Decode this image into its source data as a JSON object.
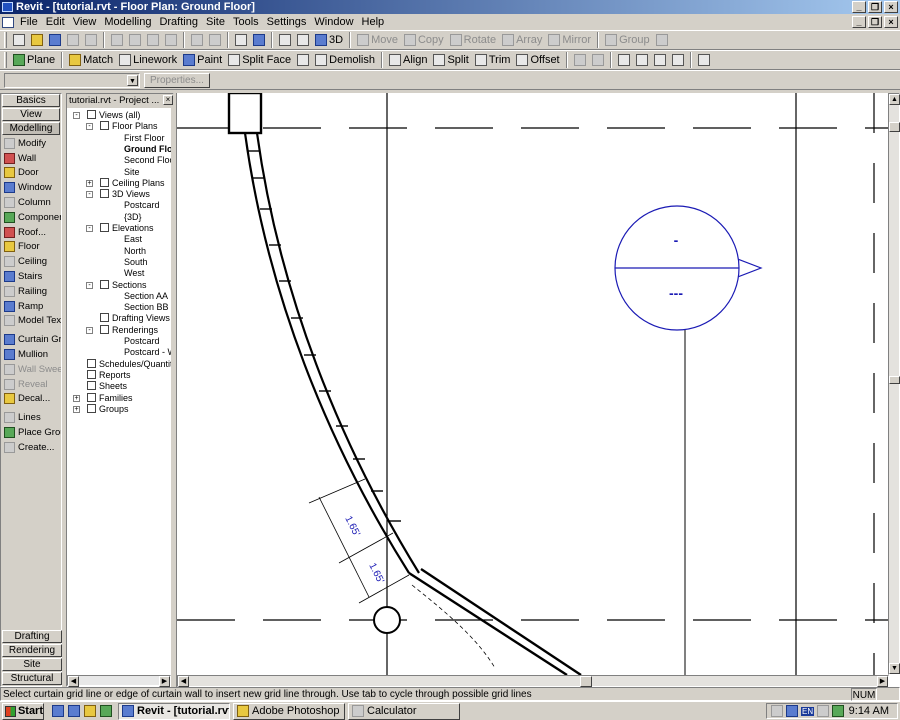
{
  "window": {
    "title": "Revit - [tutorial.rvt - Floor Plan: Ground Floor]"
  },
  "menu": [
    "File",
    "Edit",
    "View",
    "Modelling",
    "Drafting",
    "Site",
    "Tools",
    "Settings",
    "Window",
    "Help"
  ],
  "toolbar1": {
    "view_3d": "3D",
    "move": "Move",
    "copy": "Copy",
    "rotate": "Rotate",
    "array": "Array",
    "mirror": "Mirror",
    "group": "Group"
  },
  "toolbar2": {
    "plane": "Plane",
    "match": "Match",
    "linework": "Linework",
    "paint": "Paint",
    "split_face": "Split Face",
    "demolish": "Demolish",
    "align": "Align",
    "split": "Split",
    "trim": "Trim",
    "offset": "Offset"
  },
  "optionsbar": {
    "type_value": "",
    "properties": "Properties..."
  },
  "designbar": {
    "tabs_top": [
      "Basics",
      "View",
      "Modelling"
    ],
    "tools": [
      {
        "label": "Modify",
        "icon": "arrow-icon",
        "enabled": true
      },
      {
        "label": "Wall",
        "icon": "wall-icon",
        "enabled": true
      },
      {
        "label": "Door",
        "icon": "door-icon",
        "enabled": true
      },
      {
        "label": "Window",
        "icon": "window-icon",
        "enabled": true
      },
      {
        "label": "Column",
        "icon": "column-icon",
        "enabled": true
      },
      {
        "label": "Component",
        "icon": "component-icon",
        "enabled": true
      },
      {
        "label": "Roof...",
        "icon": "roof-icon",
        "enabled": true
      },
      {
        "label": "Floor",
        "icon": "floor-icon",
        "enabled": true
      },
      {
        "label": "Ceiling",
        "icon": "ceiling-icon",
        "enabled": true
      },
      {
        "label": "Stairs",
        "icon": "stairs-icon",
        "enabled": true
      },
      {
        "label": "Railing",
        "icon": "railing-icon",
        "enabled": true
      },
      {
        "label": "Ramp",
        "icon": "ramp-icon",
        "enabled": true
      },
      {
        "label": "Model Text",
        "icon": "text-icon",
        "enabled": true
      },
      {
        "label": "Curtain Grid",
        "icon": "curtain-grid-icon",
        "enabled": true
      },
      {
        "label": "Mullion",
        "icon": "mullion-icon",
        "enabled": true
      },
      {
        "label": "Wall Sweep",
        "icon": "wall-sweep-icon",
        "enabled": false
      },
      {
        "label": "Reveal",
        "icon": "reveal-icon",
        "enabled": false
      },
      {
        "label": "Decal...",
        "icon": "decal-icon",
        "enabled": true
      },
      {
        "label": "Lines",
        "icon": "lines-icon",
        "enabled": true
      },
      {
        "label": "Place Group",
        "icon": "place-group-icon",
        "enabled": true
      },
      {
        "label": "Create...",
        "icon": "create-icon",
        "enabled": true
      }
    ],
    "tabs_bottom": [
      "Drafting",
      "Rendering",
      "Site",
      "Structural"
    ]
  },
  "browser": {
    "title": "tutorial.rvt - Project ...",
    "nodes": [
      {
        "label": "Views (all)",
        "depth": 0,
        "toggle": "-",
        "bold": false
      },
      {
        "label": "Floor Plans",
        "depth": 1,
        "toggle": "-",
        "bold": false
      },
      {
        "label": "First Floor",
        "depth": 2,
        "toggle": "",
        "bold": false
      },
      {
        "label": "Ground Floor",
        "depth": 2,
        "toggle": "",
        "bold": true
      },
      {
        "label": "Second Floor",
        "depth": 2,
        "toggle": "",
        "bold": false
      },
      {
        "label": "Site",
        "depth": 2,
        "toggle": "",
        "bold": false
      },
      {
        "label": "Ceiling Plans",
        "depth": 1,
        "toggle": "+",
        "bold": false
      },
      {
        "label": "3D Views",
        "depth": 1,
        "toggle": "-",
        "bold": false
      },
      {
        "label": "Postcard",
        "depth": 2,
        "toggle": "",
        "bold": false
      },
      {
        "label": "{3D}",
        "depth": 2,
        "toggle": "",
        "bold": false
      },
      {
        "label": "Elevations",
        "depth": 1,
        "toggle": "-",
        "bold": false
      },
      {
        "label": "East",
        "depth": 2,
        "toggle": "",
        "bold": false
      },
      {
        "label": "North",
        "depth": 2,
        "toggle": "",
        "bold": false
      },
      {
        "label": "South",
        "depth": 2,
        "toggle": "",
        "bold": false
      },
      {
        "label": "West",
        "depth": 2,
        "toggle": "",
        "bold": false
      },
      {
        "label": "Sections",
        "depth": 1,
        "toggle": "-",
        "bold": false
      },
      {
        "label": "Section AA",
        "depth": 2,
        "toggle": "",
        "bold": false
      },
      {
        "label": "Section BB",
        "depth": 2,
        "toggle": "",
        "bold": false
      },
      {
        "label": "Drafting Views",
        "depth": 1,
        "toggle": "",
        "bold": false
      },
      {
        "label": "Renderings",
        "depth": 1,
        "toggle": "-",
        "bold": false
      },
      {
        "label": "Postcard",
        "depth": 2,
        "toggle": "",
        "bold": false
      },
      {
        "label": "Postcard - Wall...",
        "depth": 2,
        "toggle": "",
        "bold": false
      },
      {
        "label": "Schedules/Quantities",
        "depth": 0,
        "toggle": "",
        "bold": false
      },
      {
        "label": "Reports",
        "depth": 0,
        "toggle": "",
        "bold": false
      },
      {
        "label": "Sheets",
        "depth": 0,
        "toggle": "",
        "bold": false
      },
      {
        "label": "Families",
        "depth": 0,
        "toggle": "+",
        "bold": false
      },
      {
        "label": "Groups",
        "depth": 0,
        "toggle": "+",
        "bold": false
      }
    ]
  },
  "canvas": {
    "dim1": "1.65'",
    "dim2": "1.65'",
    "tag_top": "-",
    "tag_bottom": "---",
    "colors": {
      "annotation": "#1a1ab4",
      "line": "#000000"
    }
  },
  "status": {
    "message": "Select curtain grid line or edge of curtain wall to insert new grid line through.  Use tab to cycle through possible grid lines",
    "num": "NUM"
  },
  "taskbar": {
    "start": "Start",
    "tasks": [
      {
        "label": "Revit - [tutorial.rvt ...",
        "active": true
      },
      {
        "label": "Adobe Photoshop",
        "active": false
      },
      {
        "label": "Calculator",
        "active": false
      }
    ],
    "lang": "EN",
    "clock": "9:14 AM"
  }
}
